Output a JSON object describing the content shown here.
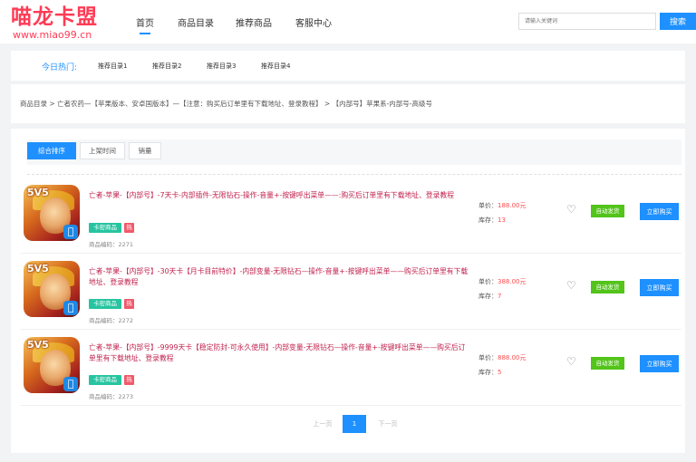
{
  "logo": {
    "title": "喵龙卡盟",
    "url": "www.miao99.cn"
  },
  "nav": [
    {
      "label": "首页"
    },
    {
      "label": "商品目录"
    },
    {
      "label": "推荐商品"
    },
    {
      "label": "客服中心"
    }
  ],
  "search": {
    "placeholder": "请输入关键词",
    "button": "搜索"
  },
  "hot": {
    "label": "今日热门:",
    "tags": [
      "推荐目录1",
      "推荐目录2",
      "推荐目录3",
      "推荐目录4"
    ]
  },
  "breadcrumb": "商品目录 > 亡者农药—【苹果版本、安卓国版本】—【注意：购买后订单里有下载地址、登录教程】 > 【内部号】苹果系-内部号-高级号",
  "sort_tabs": [
    "综合排序",
    "上架时间",
    "销量"
  ],
  "products": [
    {
      "badge": "5V5",
      "title": "亡者-苹果-【内部号】-7天卡-内部插件-无限钻石-操作-音量+-按键呼出菜单——:购买后订单里有下载地址、登录教程",
      "tag_cat": "卡密商品",
      "tag_hot": "热",
      "code_label": "商品编码：",
      "code": "2271",
      "price_label": "单价：",
      "price": "188.00",
      "price_unit": "元",
      "stock_label": "库存：",
      "stock": "13",
      "delivery": "自动发货",
      "buy": "立即购买"
    },
    {
      "badge": "5V5",
      "title": "亡者-苹果-【内部号】-30天卡【月卡目前特价】-内部变量-无限钻石—操作-音量+-按键呼出菜单——购买后订单里有下载地址、登录教程",
      "tag_cat": "卡密商品",
      "tag_hot": "热",
      "code_label": "商品编码：",
      "code": "2272",
      "price_label": "单价：",
      "price": "388.00",
      "price_unit": "元",
      "stock_label": "库存：",
      "stock": "7",
      "delivery": "自动发货",
      "buy": "立即购买"
    },
    {
      "badge": "5V5",
      "title": "亡者-苹果-【内部号】-9999天卡【稳定防封-可永久使用】-内部变量-无限钻石—操作-音量+-按键呼出菜单——购买后订单里有下载地址、登录教程",
      "tag_cat": "卡密商品",
      "tag_hot": "热",
      "code_label": "商品编码：",
      "code": "2273",
      "price_label": "单价：",
      "price": "888.00",
      "price_unit": "元",
      "stock_label": "库存：",
      "stock": "5",
      "delivery": "自动发货",
      "buy": "立即购买"
    }
  ],
  "pagination": {
    "prev": "上一页",
    "current": "1",
    "next": "下一页"
  },
  "colors": {
    "accent": "#1e90ff",
    "brand": "#ff3b55",
    "success": "#52c41a",
    "title": "#c0224d"
  }
}
